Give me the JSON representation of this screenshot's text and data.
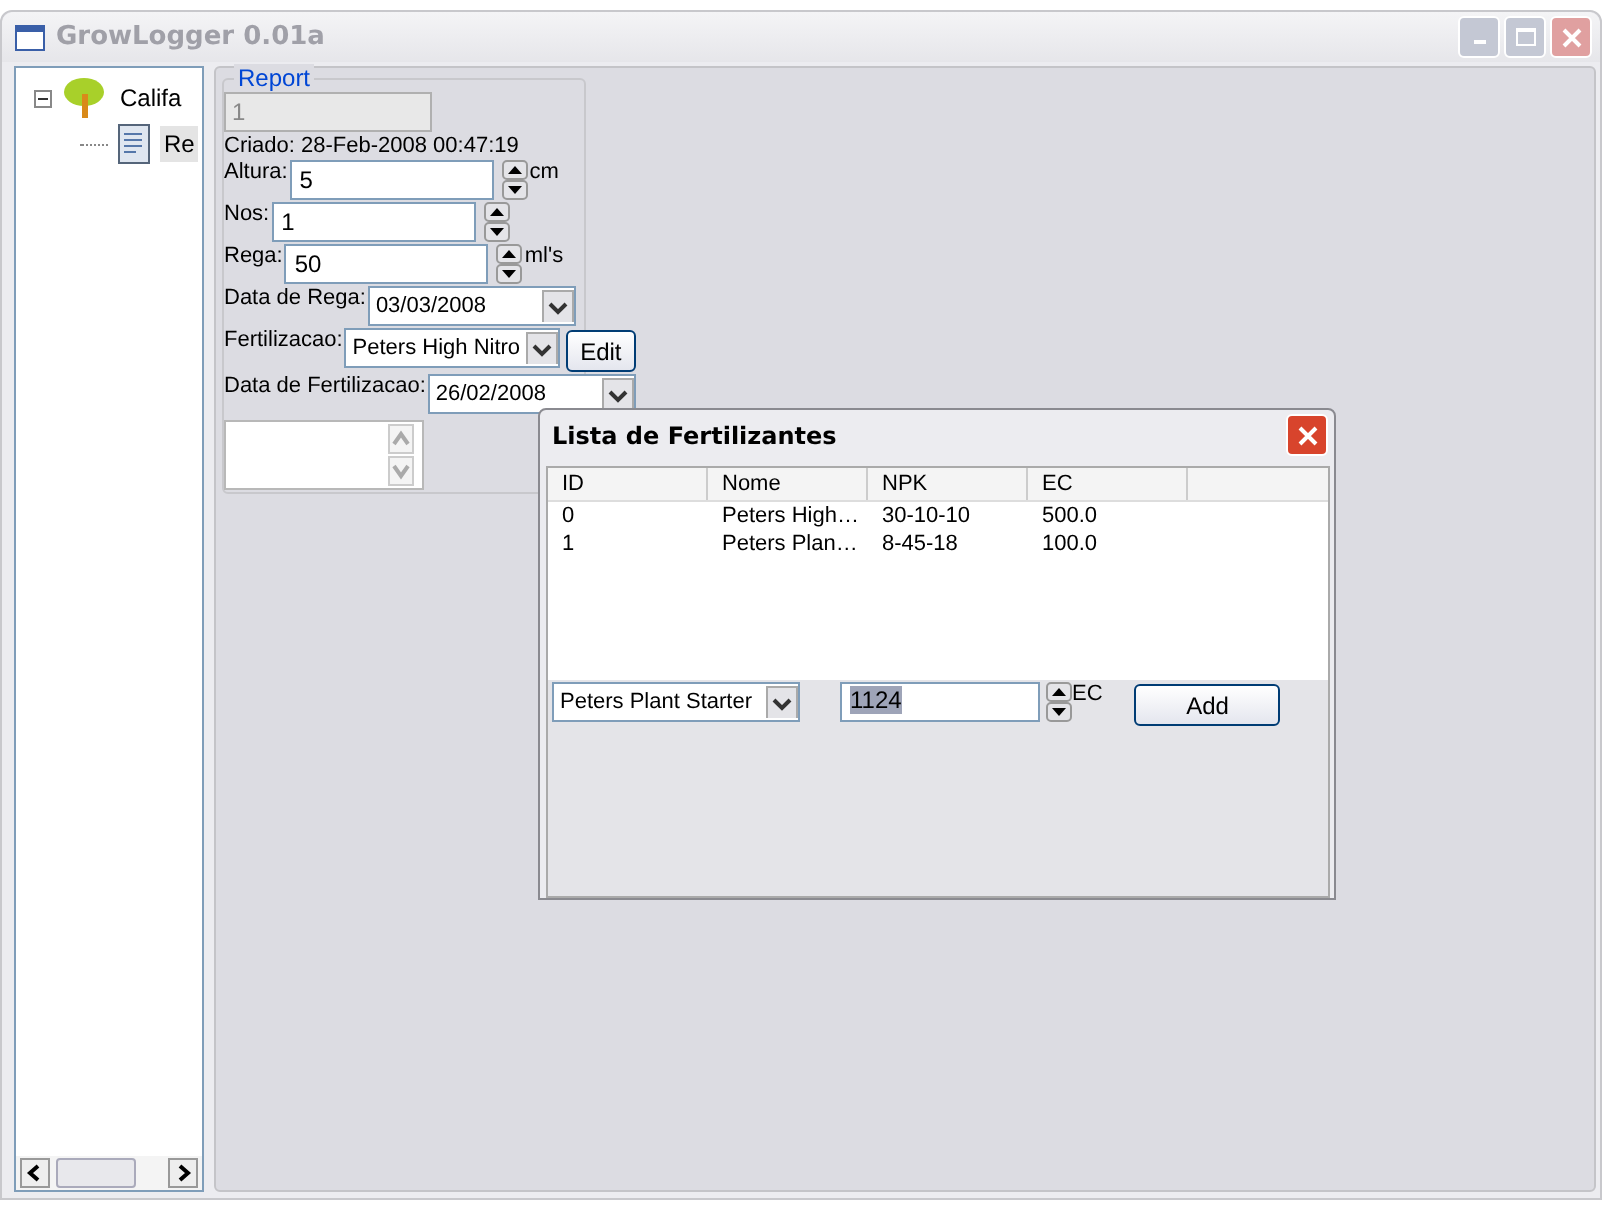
{
  "window": {
    "title": "GrowLogger 0.01a"
  },
  "tree": [
    {
      "label": "Califa",
      "expanded": true,
      "selected": false,
      "children": [
        {
          "label": "Re",
          "selected": true
        }
      ]
    }
  ],
  "report": {
    "title": "Report",
    "id_field": {
      "value": "1",
      "disabled": true
    },
    "created": "Criado: 28-Feb-2008 00:47:19",
    "fields": [
      {
        "kind": "spinner",
        "label": "Altura:",
        "value": "5",
        "unit": "cm"
      },
      {
        "kind": "spinner",
        "label": "Nos:",
        "value": "1"
      },
      {
        "kind": "spinner",
        "label": "Rega:",
        "value": "50",
        "unit": "ml's"
      },
      {
        "kind": "combo",
        "label": "Data de Rega:",
        "value": "03/03/2008"
      },
      {
        "kind": "combo",
        "label": "Fertilizacao:",
        "value": "Peters High Nitro",
        "button": "Edit"
      },
      {
        "kind": "combo",
        "label": "Data de Fertilizacao:",
        "value": "26/02/2008"
      }
    ]
  },
  "dialog": {
    "title": "Lista de Fertilizantes",
    "columns": [
      "ID",
      "Nome",
      "NPK",
      "EC"
    ],
    "rows": [
      [
        "0",
        "Peters High…",
        "30-10-10",
        "500.0"
      ],
      [
        "1",
        "Peters Plan…",
        "8-45-18",
        "100.0"
      ]
    ],
    "combo": "Peters Plant Starter",
    "ec_value": "1124",
    "ec_unit": "EC",
    "add_button": "Add"
  }
}
